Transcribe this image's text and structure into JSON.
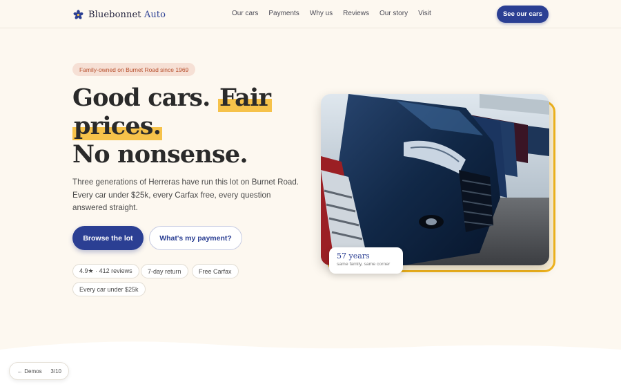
{
  "brand": {
    "name": "Bluebonnet",
    "accent": "Auto",
    "icon": "bluebonnet-flower-icon"
  },
  "nav": {
    "items": [
      {
        "label": "Our cars"
      },
      {
        "label": "Payments"
      },
      {
        "label": "Why us"
      },
      {
        "label": "Reviews"
      },
      {
        "label": "Our story"
      },
      {
        "label": "Visit"
      }
    ],
    "cta_label": "See our cars"
  },
  "hero": {
    "eyebrow": "Family-owned on Burnet Road since 1969",
    "headline": {
      "part1": "Good cars. ",
      "highlight1": "Fair",
      "highlight2": "prices.",
      "line3": "No nonsense."
    },
    "lede": "Three generations of Herreras have run this lot on Burnet Road. Every car under $25k, every Carfax free, every question answered straight.",
    "primary_button": "Browse the lot",
    "secondary_button": "What's my payment?",
    "chips": [
      "4.9★ · 412 reviews",
      "7-day return",
      "Free Carfax",
      "Every car under $25k"
    ]
  },
  "photo": {
    "alt_icon": "cars-lot-photo",
    "badge": {
      "title": "57 years",
      "subtitle": "same family, same corner"
    }
  },
  "demo_nav": {
    "back_label": "← Demos",
    "counter": "3/10"
  },
  "colors": {
    "background": "#fdf8f0",
    "primary": "#2b3f93",
    "highlight": "#f6c24a",
    "eyebrow_bg": "#f6e0d5",
    "eyebrow_text": "#b8512e",
    "photo_frame": "#f2b51d"
  }
}
